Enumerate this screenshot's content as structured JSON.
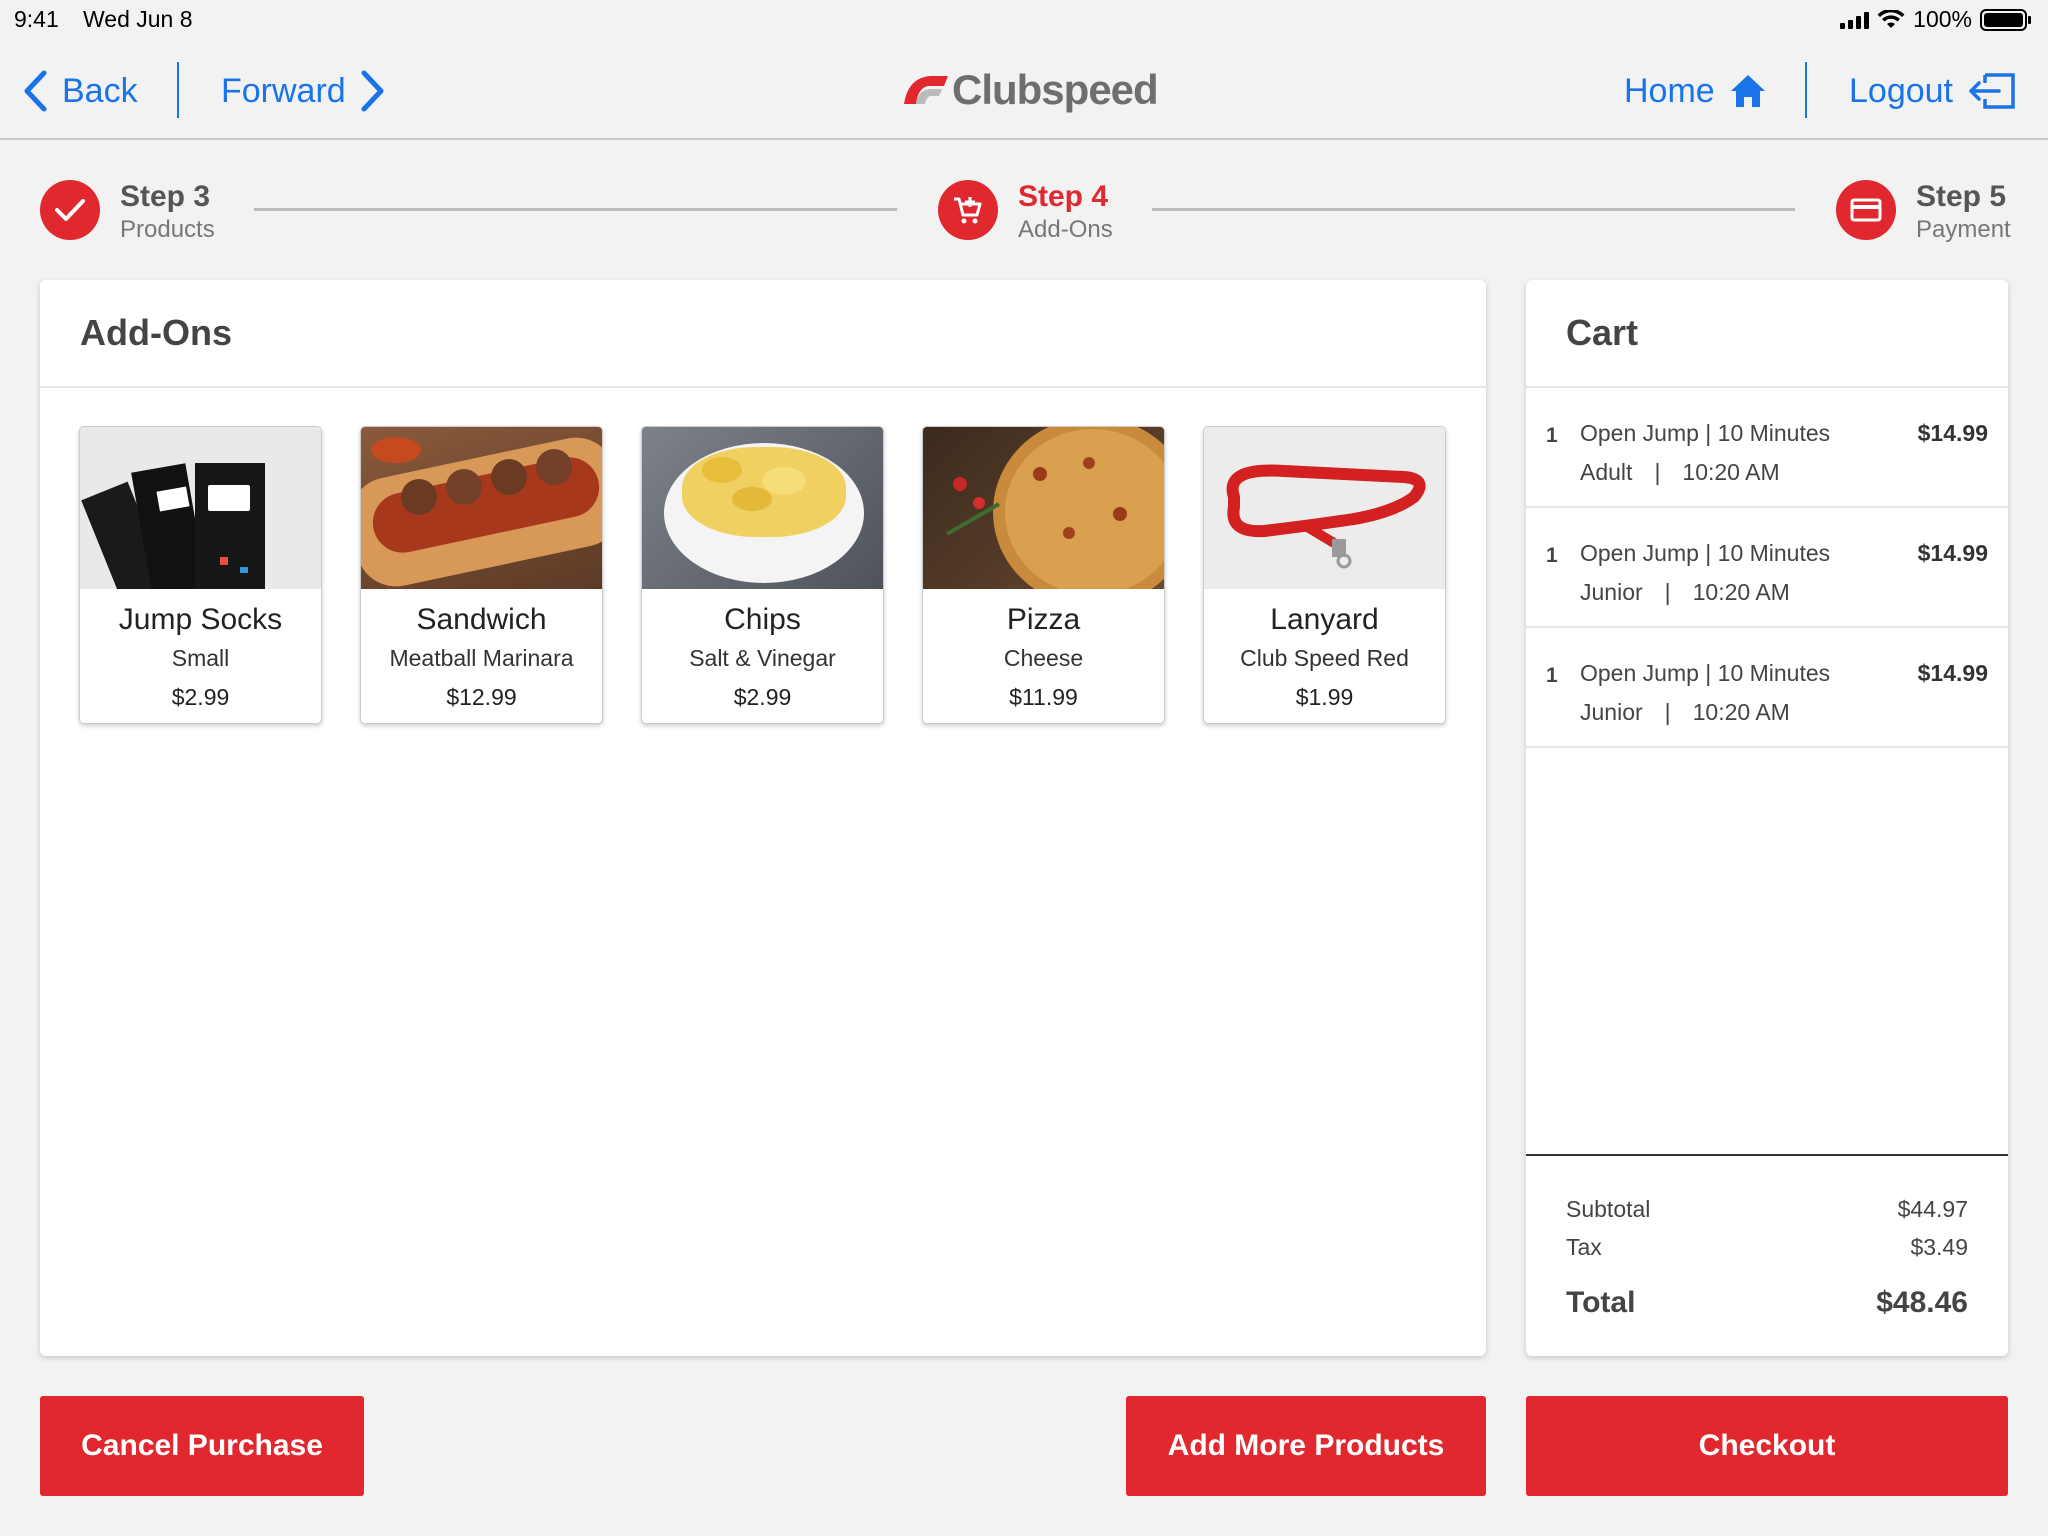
{
  "status_bar": {
    "time": "9:41",
    "date": "Wed Jun 8",
    "battery": "100%"
  },
  "nav": {
    "back_label": "Back",
    "forward_label": "Forward",
    "logo_text": "Clubspeed",
    "home_label": "Home",
    "logout_label": "Logout",
    "link_color": "#1a73e8"
  },
  "stepper": {
    "steps": [
      {
        "title": "Step 3",
        "subtitle": "Products",
        "icon": "check-icon",
        "state": "complete"
      },
      {
        "title": "Step 4",
        "subtitle": "Add-Ons",
        "icon": "cart-add-icon",
        "state": "active"
      },
      {
        "title": "Step 5",
        "subtitle": "Payment",
        "icon": "credit-card-icon",
        "state": "pending"
      }
    ]
  },
  "addons": {
    "title": "Add-Ons",
    "products": [
      {
        "name": "Jump Socks",
        "variant": "Small",
        "price": "$2.99",
        "image": "socks-photo"
      },
      {
        "name": "Sandwich",
        "variant": "Meatball Marinara",
        "price": "$12.99",
        "image": "sandwich-photo"
      },
      {
        "name": "Chips",
        "variant": "Salt & Vinegar",
        "price": "$2.99",
        "image": "chips-photo"
      },
      {
        "name": "Pizza",
        "variant": "Cheese",
        "price": "$11.99",
        "image": "pizza-photo"
      },
      {
        "name": "Lanyard",
        "variant": "Club Speed Red",
        "price": "$1.99",
        "image": "lanyard-photo"
      }
    ]
  },
  "cart": {
    "title": "Cart",
    "items": [
      {
        "qty": "1",
        "name": "Open Jump | 10 Minutes",
        "type": "Adult",
        "separator": "|",
        "time": "10:20 AM",
        "price": "$14.99"
      },
      {
        "qty": "1",
        "name": "Open Jump | 10 Minutes",
        "type": "Junior",
        "separator": "|",
        "time": "10:20 AM",
        "price": "$14.99"
      },
      {
        "qty": "1",
        "name": "Open Jump | 10 Minutes",
        "type": "Junior",
        "separator": "|",
        "time": "10:20 AM",
        "price": "$14.99"
      }
    ],
    "subtotal_label": "Subtotal",
    "subtotal_value": "$44.97",
    "tax_label": "Tax",
    "tax_value": "$3.49",
    "total_label": "Total",
    "total_value": "$48.46"
  },
  "actions": {
    "cancel_label": "Cancel Purchase",
    "add_more_label": "Add More Products",
    "checkout_label": "Checkout"
  },
  "colors": {
    "brand_red": "#e0282e",
    "link_blue": "#1a73e8"
  }
}
